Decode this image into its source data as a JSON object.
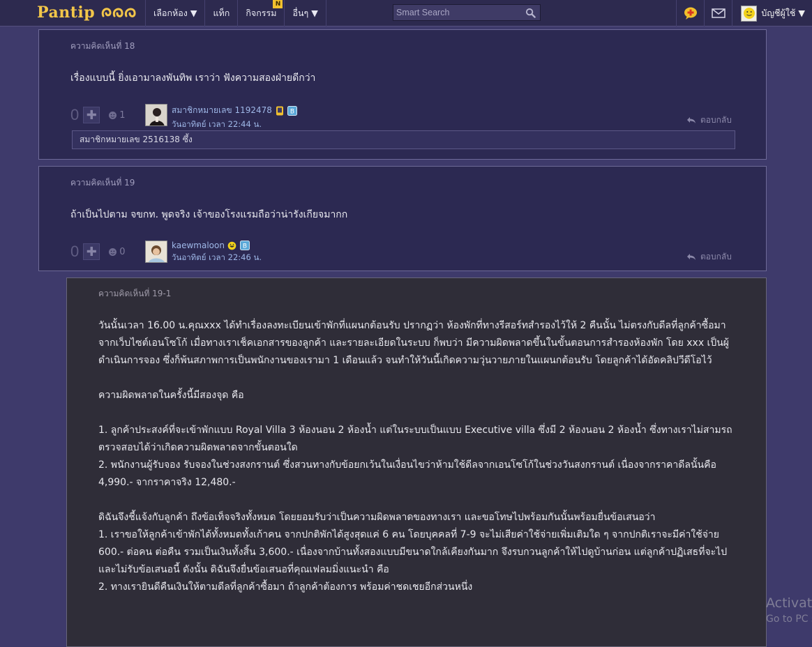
{
  "nav": {
    "logo": "Pantip",
    "menu": [
      {
        "label": "เลือกห้อง ▼"
      },
      {
        "label": "แท็ก"
      },
      {
        "label": "กิจกรรม",
        "badge": "N"
      },
      {
        "label": "อื่นๆ ▼"
      }
    ],
    "search_placeholder": "Smart Search",
    "account_label": "บัญชีผู้ใช้ ▼"
  },
  "comments": [
    {
      "label": "ความคิดเห็นที่ 18",
      "text": "เรื่องแบบนี้ ยิ่งเอามาลงพันทิพ เราว่า ฟังความสองฝ่ายดีกว่า",
      "score": "0",
      "emotion_count": "1",
      "user": "สมาชิกหมายเลข 1192478",
      "time": "วันอาทิตย์ เวลา 22:44 น.",
      "reply_label": "ตอบกลับ",
      "quote": "สมาชิกหมายเลข 2516138 ซึ้ง"
    },
    {
      "label": "ความคิดเห็นที่ 19",
      "text": "ถ้าเป็นไปตาม จขกท. พูดจริง เจ้าของโรงแรมถือว่าน่ารังเกียจมากก",
      "score": "0",
      "emotion_count": "0",
      "user": "kaewmaloon",
      "time": "วันอาทิตย์ เวลา 22:46 น.",
      "reply_label": "ตอบกลับ"
    }
  ],
  "subcomment": {
    "label": "ความคิดเห็นที่ 19-1",
    "paragraphs": [
      "วันนั้นเวลา 16.00 น.คุณxxx ได้ทำเรื่องลงทะเบียนเข้าพักที่แผนกต้อนรับ ปรากฏว่า ห้องพักที่ทางรีสอร์ทสำรองไว้ให้ 2 คืนนั้น ไม่ตรงกับดีลที่ลูกค้าซื้อมาจากเว็บไซต์เอนโซโก้ เมื่อทางเราเช็คเอกสารของลูกค้า และรายละเอียดในระบบ ก็พบว่า มีความผิดพลาดขึ้นในขั้นตอนการสำรองห้องพัก โดย xxx เป็นผู้ดำเนินการจอง ซึ่งก็พ้นสภาพการเป็นพนักงานของเรามา 1 เดือนแล้ว จนทำให้วันนี้เกิดความวุ่นวายภายในแผนกต้อนรับ โดยลูกค้าได้อัดคลิปวีดีโอไว้",
      "",
      "ความผิดพลาดในครั้งนี้มีสองจุด คือ",
      "",
      "1. ลูกค้าประสงค์ที่จะเข้าพักแบบ Royal Villa 3 ห้องนอน 2 ห้องน้ำ แต่ในระบบเป็นแบบ Executive villa ซึ่งมี 2 ห้องนอน 2 ห้องน้ำ ซึ่งทางเราไม่สามรถตรวจสอบได้ว่าเกิดความผิดพลาดจากขั้นตอนใด",
      "2. พนักงานผู้รับจอง รับจองในช่วงสงกรานต์ ซึ่งสวนทางกับข้อยกเว้นในเงื่อนไขว่าห้ามใช้ดีลจากเอนโซโก้ในช่วงวันสงกรานต์ เนื่องจากราคาดีลนั้นคือ 4,990.- จากราคาจริง 12,480.-",
      "",
      "ดิฉันจึงชี้แจ้งกับลูกค้า ถึงข้อเท็จจริงทั้งหมด โดยยอมรับว่าเป็นความผิดพลาดของทางเรา และขอโทษไปพร้อมกันนั้นพร้อมยื่นข้อเสนอว่า",
      "1. เราขอให้ลูกค้าเข้าพักได้ทั้งหมดทั้งเก้าคน จากปกติพักได้สูงสุดแค่ 6 คน โดยบุคคลที่ 7-9 จะไม่เสียค่าใช้จ่ายเพิ่มเติมใด ๆ จากปกติเราจะมีค่าใช้จ่าย 600.- ต่อคน ต่อคืน รวมเป็นเงินทั้งสิ้น 3,600.- เนื่องจากบ้านทั้งสองแบบมีขนาดใกล้เคียงกันมาก จึงรบกวนลูกค้าให้ไปดูบ้านก่อน แต่ลูกค้าปฏิเสธที่จะไปและไม่รับข้อเสนอนี้ ดังนั้น ดิฉันจึงยื่นข้อเสนอที่คุณเฟลมมิ่งแนะนำ คือ",
      "2. ทางเรายินดีคืนเงินให้ตามดีลที่ลูกค้าซื้อมา ถ้าลูกค้าต้องการ พร้อมค่าชดเชยอีกส่วนหนึ่ง"
    ]
  },
  "watermark": {
    "line1": "Activate",
    "line2": "Go to PC s"
  }
}
